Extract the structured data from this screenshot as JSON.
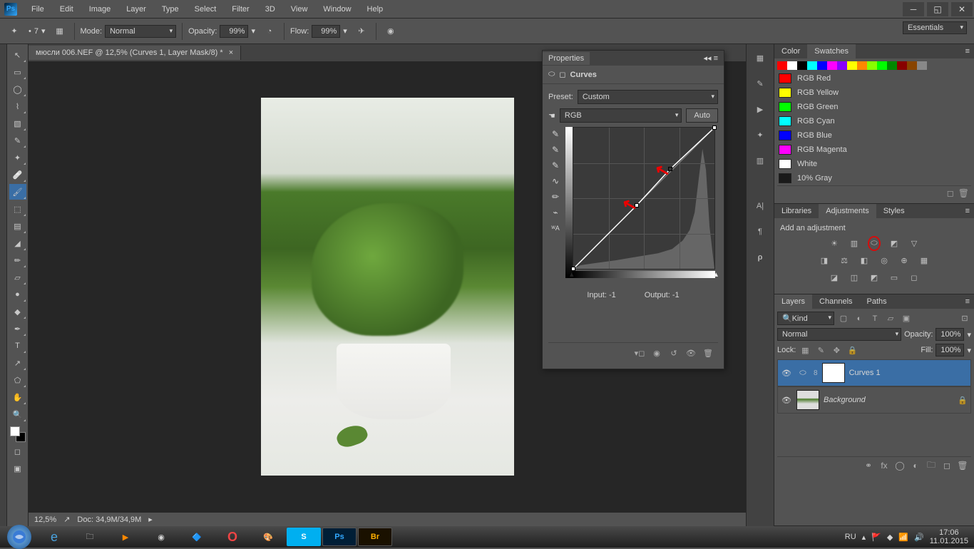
{
  "menu": [
    "File",
    "Edit",
    "Image",
    "Layer",
    "Type",
    "Select",
    "Filter",
    "3D",
    "View",
    "Window",
    "Help"
  ],
  "workspace": "Essentials",
  "optbar": {
    "mode_label": "Mode:",
    "mode": "Normal",
    "opacity_label": "Opacity:",
    "opacity": "99%",
    "flow_label": "Flow:",
    "flow": "99%",
    "size": "7"
  },
  "doc": {
    "tab": "мюсли 006.NEF @ 12,5% (Curves 1, Layer Mask/8) *",
    "zoom": "12,5%",
    "docinfo": "Doc: 34,9M/34,9M"
  },
  "props": {
    "title": "Properties",
    "sub": "Curves",
    "preset_label": "Preset:",
    "preset": "Custom",
    "channel": "RGB",
    "auto": "Auto",
    "input_label": "Input:",
    "input": "-1",
    "output_label": "Output:",
    "output": "-1"
  },
  "color": {
    "tabs": [
      "Color",
      "Swatches"
    ],
    "rows": [
      {
        "c": "#ff0000",
        "n": "RGB Red"
      },
      {
        "c": "#ffff00",
        "n": "RGB Yellow"
      },
      {
        "c": "#00ff00",
        "n": "RGB Green"
      },
      {
        "c": "#00ffff",
        "n": "RGB Cyan"
      },
      {
        "c": "#0000ff",
        "n": "RGB Blue"
      },
      {
        "c": "#ff00ff",
        "n": "RGB Magenta"
      },
      {
        "c": "#ffffff",
        "n": "White"
      },
      {
        "c": "#1a1a1a",
        "n": "10% Gray"
      }
    ],
    "bar": [
      "#ff0000",
      "#ffffff",
      "#000000",
      "#00ffff",
      "#0000ff",
      "#ff00ff",
      "#8800ff",
      "#ffff00",
      "#ff8800",
      "#88ff00",
      "#00ff00",
      "#008800",
      "#880000",
      "#884400",
      "#888888"
    ]
  },
  "adj": {
    "tabs": [
      "Libraries",
      "Adjustments",
      "Styles"
    ],
    "title": "Add an adjustment"
  },
  "layers": {
    "tabs": [
      "Layers",
      "Channels",
      "Paths"
    ],
    "kind": "Kind",
    "blend": "Normal",
    "op_label": "Opacity:",
    "op": "100%",
    "fill_label": "Fill:",
    "fill": "100%",
    "lock_label": "Lock:",
    "l1": "Curves 1",
    "l2": "Background"
  },
  "tray": {
    "lang": "RU",
    "time": "17:06",
    "date": "11.01.2015"
  },
  "chart_data": {
    "type": "line",
    "title": "Curves — RGB",
    "xlabel": "Input",
    "ylabel": "Output",
    "xlim": [
      0,
      255
    ],
    "ylim": [
      0,
      255
    ],
    "series": [
      {
        "name": "RGB",
        "values": [
          [
            0,
            0
          ],
          [
            115,
            115
          ],
          [
            175,
            180
          ],
          [
            255,
            255
          ]
        ]
      }
    ],
    "histogram_note": "luminosity histogram with strong peak near highlights ~230-245"
  }
}
